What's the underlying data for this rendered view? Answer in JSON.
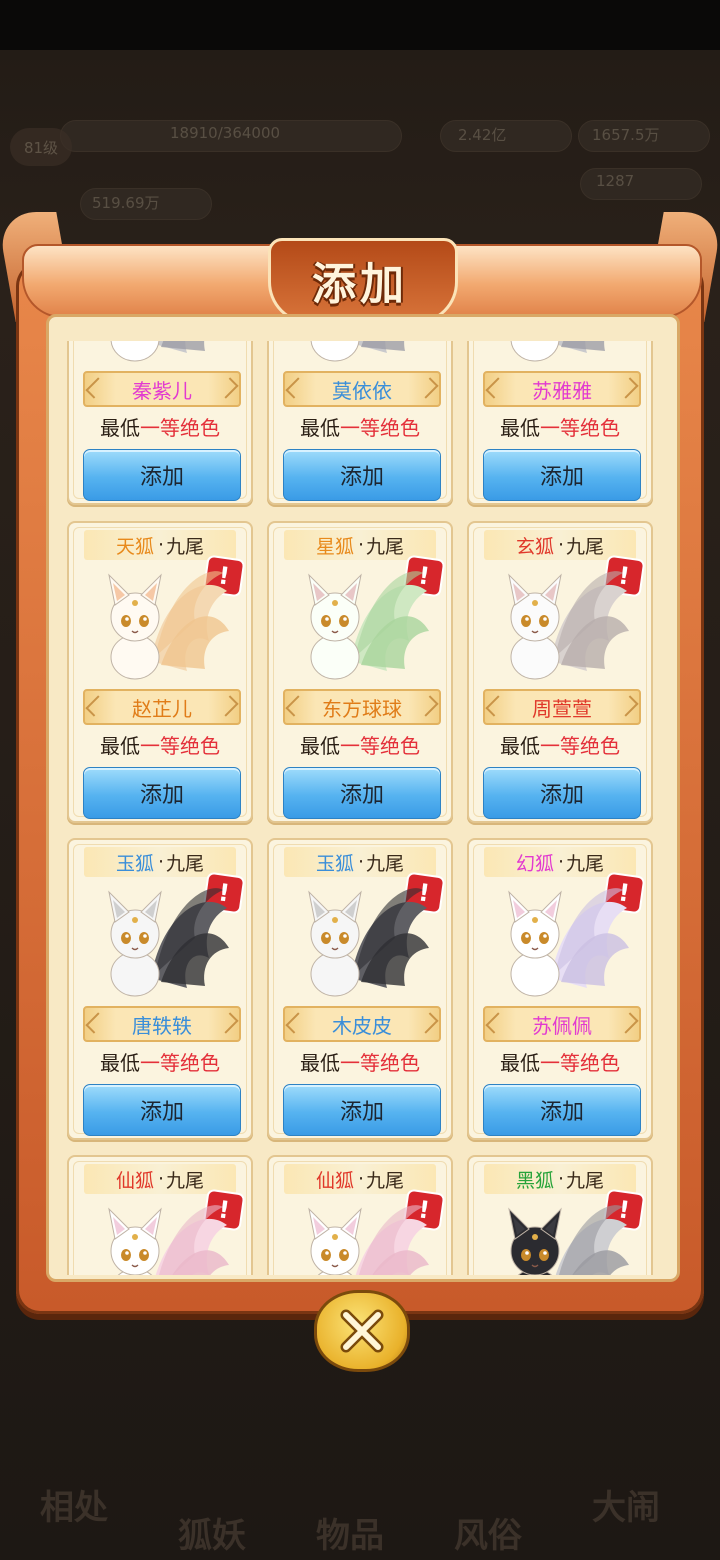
{
  "background": {
    "level": "81级",
    "exp": "18910/364000",
    "stat_a": "2.42亿",
    "stat_b": "1657.5万",
    "gold": "519.69万",
    "stat_c": "1287",
    "bottom_tabs": [
      "相处",
      "狐妖",
      "物品",
      "风俗",
      "大闹"
    ]
  },
  "modal": {
    "title": "添加",
    "close_icon": "close-x-icon",
    "grade_prefix": "最低",
    "grade_value": "一等绝色",
    "add_label": "添加",
    "alert_glyph": "!",
    "tail_label": "九尾",
    "dot": "·"
  },
  "colors": {
    "pink_name": "#e23ad0",
    "blue_name": "#3a8ed9",
    "gold_name": "#e07c18",
    "green_class": "#27a33a",
    "red_class": "#e0382a"
  },
  "cards": [
    {
      "cls": "",
      "name": "秦紫儿",
      "name_color": "#e23ad0",
      "fox": "white"
    },
    {
      "cls": "",
      "name": "莫依依",
      "name_color": "#3a8ed9",
      "fox": "white"
    },
    {
      "cls": "",
      "name": "苏雅雅",
      "name_color": "#e23ad0",
      "fox": "white"
    },
    {
      "cls": "天狐",
      "cls_color": "#e88a1c",
      "name": "赵芷儿",
      "name_color": "#e07c18",
      "fox": "cream"
    },
    {
      "cls": "星狐",
      "cls_color": "#e88a1c",
      "name": "东方球球",
      "name_color": "#e07c18",
      "fox": "green"
    },
    {
      "cls": "玄狐",
      "cls_color": "#e0382a",
      "name": "周萱萱",
      "name_color": "#e0382a",
      "fox": "grey"
    },
    {
      "cls": "玉狐",
      "cls_color": "#3a8ed9",
      "name": "唐轶轶",
      "name_color": "#3a8ed9",
      "fox": "black"
    },
    {
      "cls": "玉狐",
      "cls_color": "#3a8ed9",
      "name": "木皮皮",
      "name_color": "#3a8ed9",
      "fox": "black"
    },
    {
      "cls": "幻狐",
      "cls_color": "#e23ad0",
      "name": "苏佩佩",
      "name_color": "#e23ad0",
      "fox": "lilac"
    },
    {
      "cls": "仙狐",
      "cls_color": "#e0382a",
      "name": "",
      "name_color": "#e0382a",
      "fox": "pink"
    },
    {
      "cls": "仙狐",
      "cls_color": "#e0382a",
      "name": "",
      "name_color": "#e0382a",
      "fox": "pink"
    },
    {
      "cls": "黑狐",
      "cls_color": "#27a33a",
      "name": "",
      "name_color": "#27a33a",
      "fox": "dark"
    }
  ]
}
